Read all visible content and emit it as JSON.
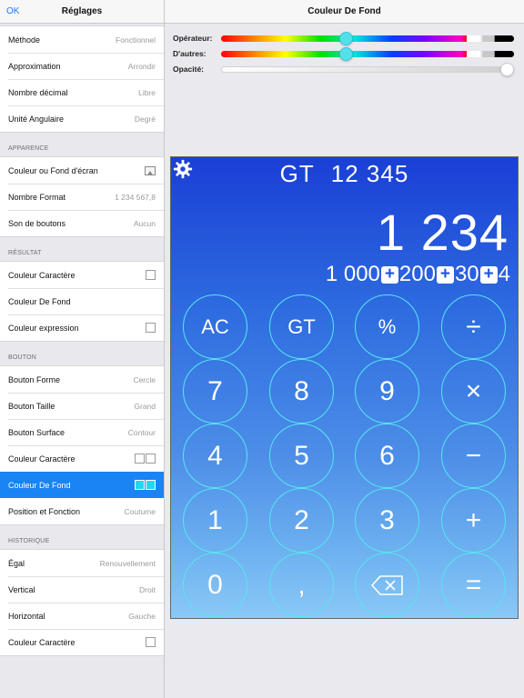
{
  "sidebar": {
    "ok_label": "OK",
    "title": "Réglages",
    "group1": [
      {
        "label": "Méthode",
        "value": "Fonctionnel"
      },
      {
        "label": "Approximation",
        "value": "Arrondir"
      },
      {
        "label": "Nombre décimal",
        "value": "Libre"
      },
      {
        "label": "Unité Angulaire",
        "value": "Degré"
      }
    ],
    "section_apparence": "APPARENCE",
    "apparence": [
      {
        "label": "Couleur ou Fond d'écran"
      },
      {
        "label": "Nombre Format",
        "value": "1 234 567,8"
      },
      {
        "label": "Son de boutons",
        "value": "Aucun"
      }
    ],
    "section_resultat": "RÉSULTAT",
    "resultat": [
      {
        "label": "Couleur Caractère"
      },
      {
        "label": "Couleur De Fond"
      },
      {
        "label": "Couleur expression"
      }
    ],
    "section_bouton": "BOUTON",
    "bouton": [
      {
        "label": "Bouton Forme",
        "value": "Cercle"
      },
      {
        "label": "Bouton Taille",
        "value": "Grand"
      },
      {
        "label": "Bouton Surface",
        "value": "Contour"
      },
      {
        "label": "Couleur Caractère"
      },
      {
        "label": "Couleur De Fond"
      },
      {
        "label": "Position et Fonction",
        "value": "Coutume"
      }
    ],
    "section_historique": "HISTORIQUE",
    "historique": [
      {
        "label": "Égal",
        "value": "Renouvellement"
      },
      {
        "label": "Vertical",
        "value": "Droit"
      },
      {
        "label": "Horizontal",
        "value": "Gauche"
      },
      {
        "label": "Couleur Caractère"
      }
    ]
  },
  "main": {
    "title": "Couleur De Fond",
    "sliders": [
      {
        "label": "Opérateur:",
        "position": 0.43
      },
      {
        "label": "D'autres:",
        "position": 0.43
      },
      {
        "label": "Opacité:",
        "position": 1.0
      }
    ]
  },
  "calculator": {
    "gt_label": "GT",
    "gt_value": "12 345",
    "display": "1 234",
    "expr": [
      "1 000",
      "200",
      "30",
      "4"
    ],
    "operator_symbol": "+",
    "buttons": [
      [
        "AC",
        "GT",
        "%",
        "÷"
      ],
      [
        "7",
        "8",
        "9",
        "×"
      ],
      [
        "4",
        "5",
        "6",
        "−"
      ],
      [
        "1",
        "2",
        "3",
        "+"
      ],
      [
        "0",
        ",",
        "⌫",
        "="
      ]
    ],
    "colors": {
      "button_border": "#56e6f0",
      "gradient_top": "#1a3fd6",
      "gradient_bottom": "#8ac8f6"
    }
  }
}
